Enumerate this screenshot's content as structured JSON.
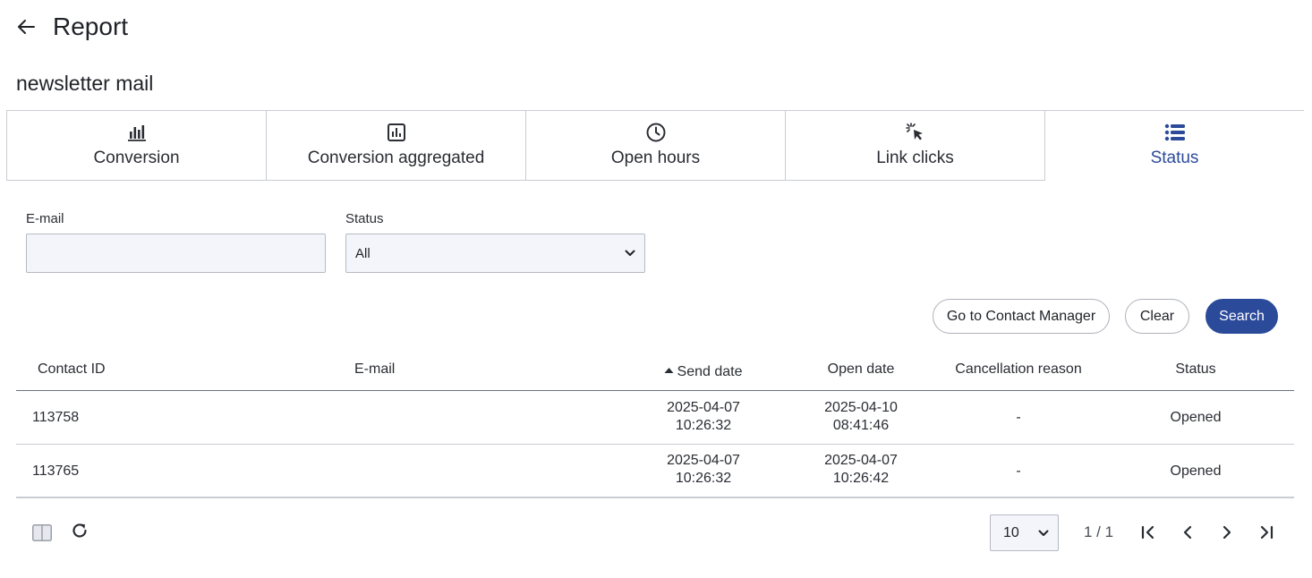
{
  "header": {
    "title": "Report"
  },
  "subtitle": "newsletter mail",
  "tabs": [
    {
      "label": "Conversion",
      "icon": "bar-chart-icon"
    },
    {
      "label": "Conversion aggregated",
      "icon": "chart-box-icon"
    },
    {
      "label": "Open hours",
      "icon": "clock-icon"
    },
    {
      "label": "Link clicks",
      "icon": "cursor-click-icon"
    },
    {
      "label": "Status",
      "icon": "list-icon"
    }
  ],
  "filters": {
    "email_label": "E-mail",
    "email_value": "",
    "status_label": "Status",
    "status_value": "All"
  },
  "buttons": {
    "contact_manager": "Go to Contact Manager",
    "clear": "Clear",
    "search": "Search"
  },
  "table": {
    "headers": {
      "contact_id": "Contact ID",
      "email": "E-mail",
      "send_date": "Send date",
      "open_date": "Open date",
      "cancellation_reason": "Cancellation reason",
      "status": "Status"
    },
    "rows": [
      {
        "contact_id": "113758",
        "email": "",
        "send_date": "2025-04-07",
        "send_time": "10:26:32",
        "open_date": "2025-04-10",
        "open_time": "08:41:46",
        "cancellation_reason": "-",
        "status": "Opened"
      },
      {
        "contact_id": "113765",
        "email": "",
        "send_date": "2025-04-07",
        "send_time": "10:26:32",
        "open_date": "2025-04-07",
        "open_time": "10:26:42",
        "cancellation_reason": "-",
        "status": "Opened"
      }
    ]
  },
  "pagination": {
    "page_size": "10",
    "page_info": "1 / 1"
  },
  "colors": {
    "accent": "#2c4a9a",
    "border": "#c9ccd2"
  }
}
